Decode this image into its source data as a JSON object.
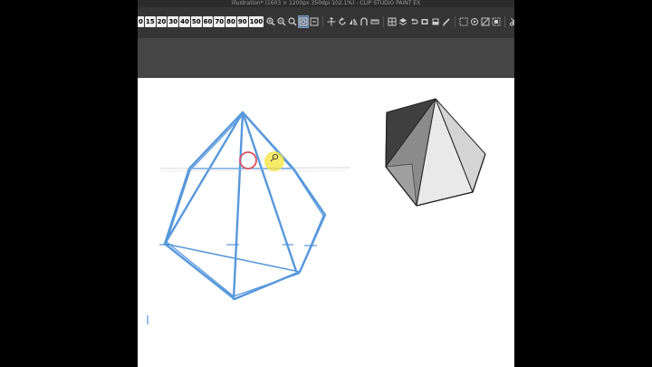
{
  "window": {
    "title": "illustration* (1603 × 1200px 350dpi 102.1%)  - CLIP STUDIO PAINT EX"
  },
  "toolbar": {
    "zoom_presets": [
      "0",
      "15",
      "20",
      "30",
      "40",
      "50",
      "60",
      "70",
      "80",
      "90",
      "100"
    ],
    "tool_icons": [
      "zoom-in-icon",
      "zoom-out-icon",
      "zoom-fit-icon",
      "fit-window-icon",
      "reset-zoom-icon",
      "move-layer-icon",
      "rotate-icon",
      "flip-icon",
      "snap-icon",
      "ruler-icon",
      "grid-icon",
      "layer-icon",
      "undo-icon",
      "redo-icon",
      "fill-icon",
      "erase-icon",
      "transform-icon",
      "select-all-icon",
      "deselect-icon",
      "invert-selection-icon",
      "cut-icon",
      "copy-icon",
      "paste-icon"
    ]
  },
  "colors": {
    "sketch_line": "#4a90d9",
    "brush_cursor": "#e05060",
    "click_highlight": "#f3e43a",
    "app_background": "#404040"
  }
}
